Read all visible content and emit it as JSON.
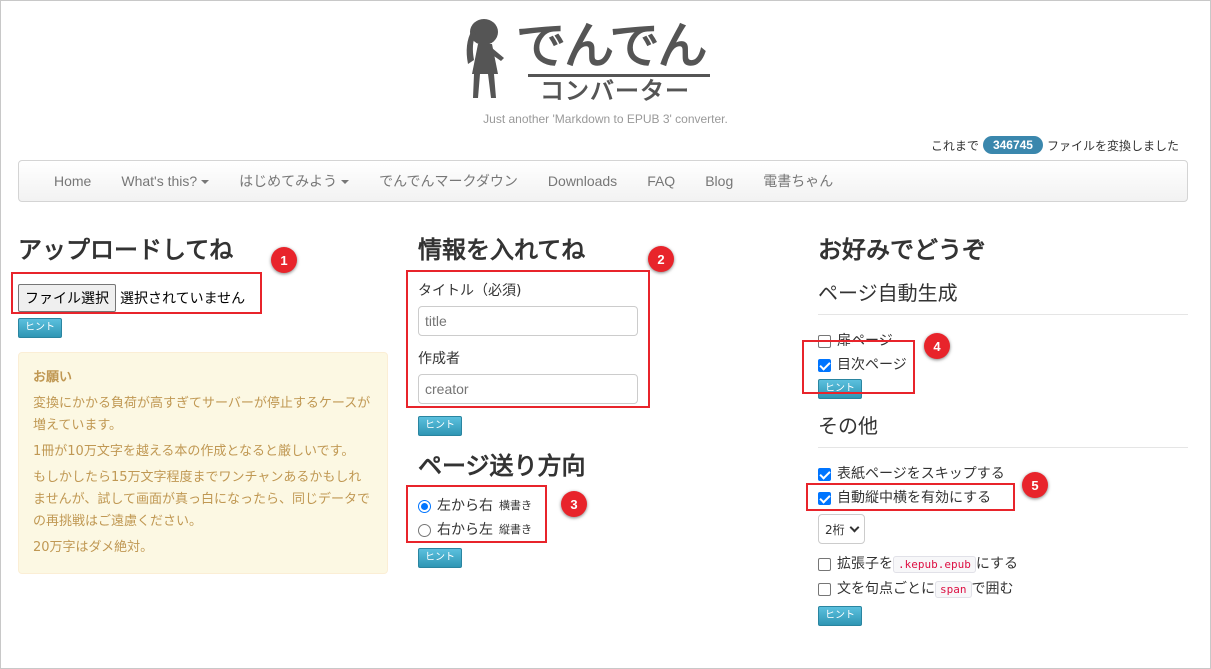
{
  "header": {
    "logo_main": "でんでん",
    "logo_sub": "コンバーター",
    "tagline": "Just another 'Markdown to EPUB 3' converter.",
    "counter_prefix": "これまで",
    "counter_value": "346745",
    "counter_suffix": "ファイルを変換しました"
  },
  "nav": {
    "items": [
      "Home",
      "What's this?",
      "はじめてみよう",
      "でんでんマークダウン",
      "Downloads",
      "FAQ",
      "Blog",
      "電書ちゃん"
    ]
  },
  "upload": {
    "title": "アップロードしてね",
    "file_button": "ファイル選択",
    "file_status": "選択されていません",
    "hint": "ヒント",
    "alert_title": "お願い",
    "alert_lines": [
      "変換にかかる負荷が高すぎてサーバーが停止するケースが増えています。",
      "1冊が10万文字を越える本の作成となると厳しいです。",
      "もしかしたら15万文字程度までワンチャンあるかもしれませんが、試して画面が真っ白になったら、同じデータでの再挑戦はご遠慮ください。",
      "20万字はダメ絶対。"
    ]
  },
  "info": {
    "title": "情報を入れてね",
    "title_label": "タイトル（必須)",
    "title_placeholder": "title",
    "author_label": "作成者",
    "author_placeholder": "creator",
    "hint": "ヒント"
  },
  "direction": {
    "title": "ページ送り方向",
    "ltr_label": "左から右",
    "ltr_small": "横書き",
    "rtl_label": "右から左",
    "rtl_small": "縦書き",
    "hint": "ヒント"
  },
  "prefs": {
    "title": "お好みでどうぞ",
    "autogen_title": "ページ自動生成",
    "cover_page": "扉ページ",
    "toc_page": "目次ページ",
    "hint": "ヒント",
    "other_title": "その他",
    "skip_cover": "表紙ページをスキップする",
    "tcy": "自動縦中横を有効にする",
    "tcy_select": "2桁",
    "ext_pre": "拡張子を",
    "ext_code": ".kepub.epub",
    "ext_post": "にする",
    "span_pre": "文を句点ごとに",
    "span_code": "span",
    "span_post": "で囲む",
    "hint2": "ヒント"
  },
  "markers": [
    "1",
    "2",
    "3",
    "4",
    "5"
  ],
  "colors": {
    "annotation_red": "#e8242b",
    "badge_blue": "#3a87ad",
    "hint_blue": "#2f96b4",
    "checkbox_blue": "#0075ff",
    "alert_text": "#c09853"
  }
}
